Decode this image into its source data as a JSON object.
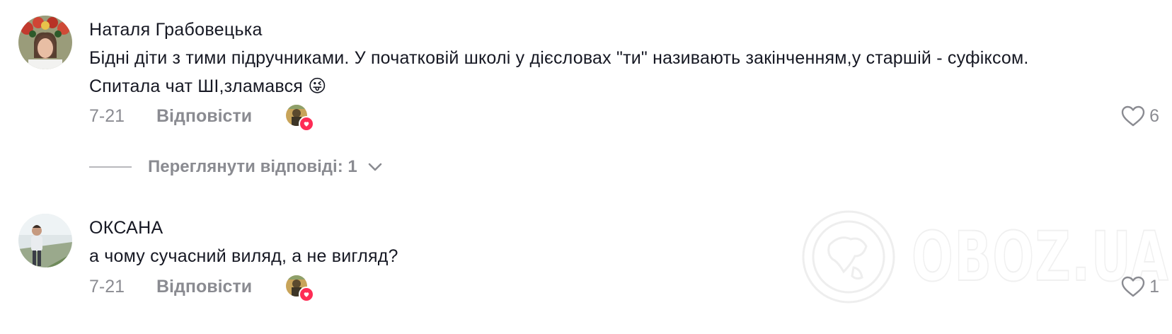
{
  "comments": [
    {
      "username": "Наталя Грабовецька",
      "text": "Бідні діти з тими підручниками. У початковій школі у дієсловах \"ти\" називають закінченням,у старшій - суфіксом. Спитала чат ШІ,зламався 😜",
      "date": "7-21",
      "reply_label": "Відповісти",
      "likes": "6",
      "view_replies": "Переглянути відповіді: 1"
    },
    {
      "username": "ОКСАНА",
      "text": "а чому сучасний виляд, а не вигляд?",
      "date": "7-21",
      "reply_label": "Відповісти",
      "likes": "1"
    }
  ],
  "watermark": {
    "text": "OBOZ.UA"
  },
  "colors": {
    "text": "#161823",
    "muted": "#8a8b91",
    "accent": "#fe2c55"
  },
  "icons": [
    "heart-outline-icon",
    "chevron-down-icon",
    "creator-liked-heart-icon",
    "globe-logo-icon"
  ]
}
